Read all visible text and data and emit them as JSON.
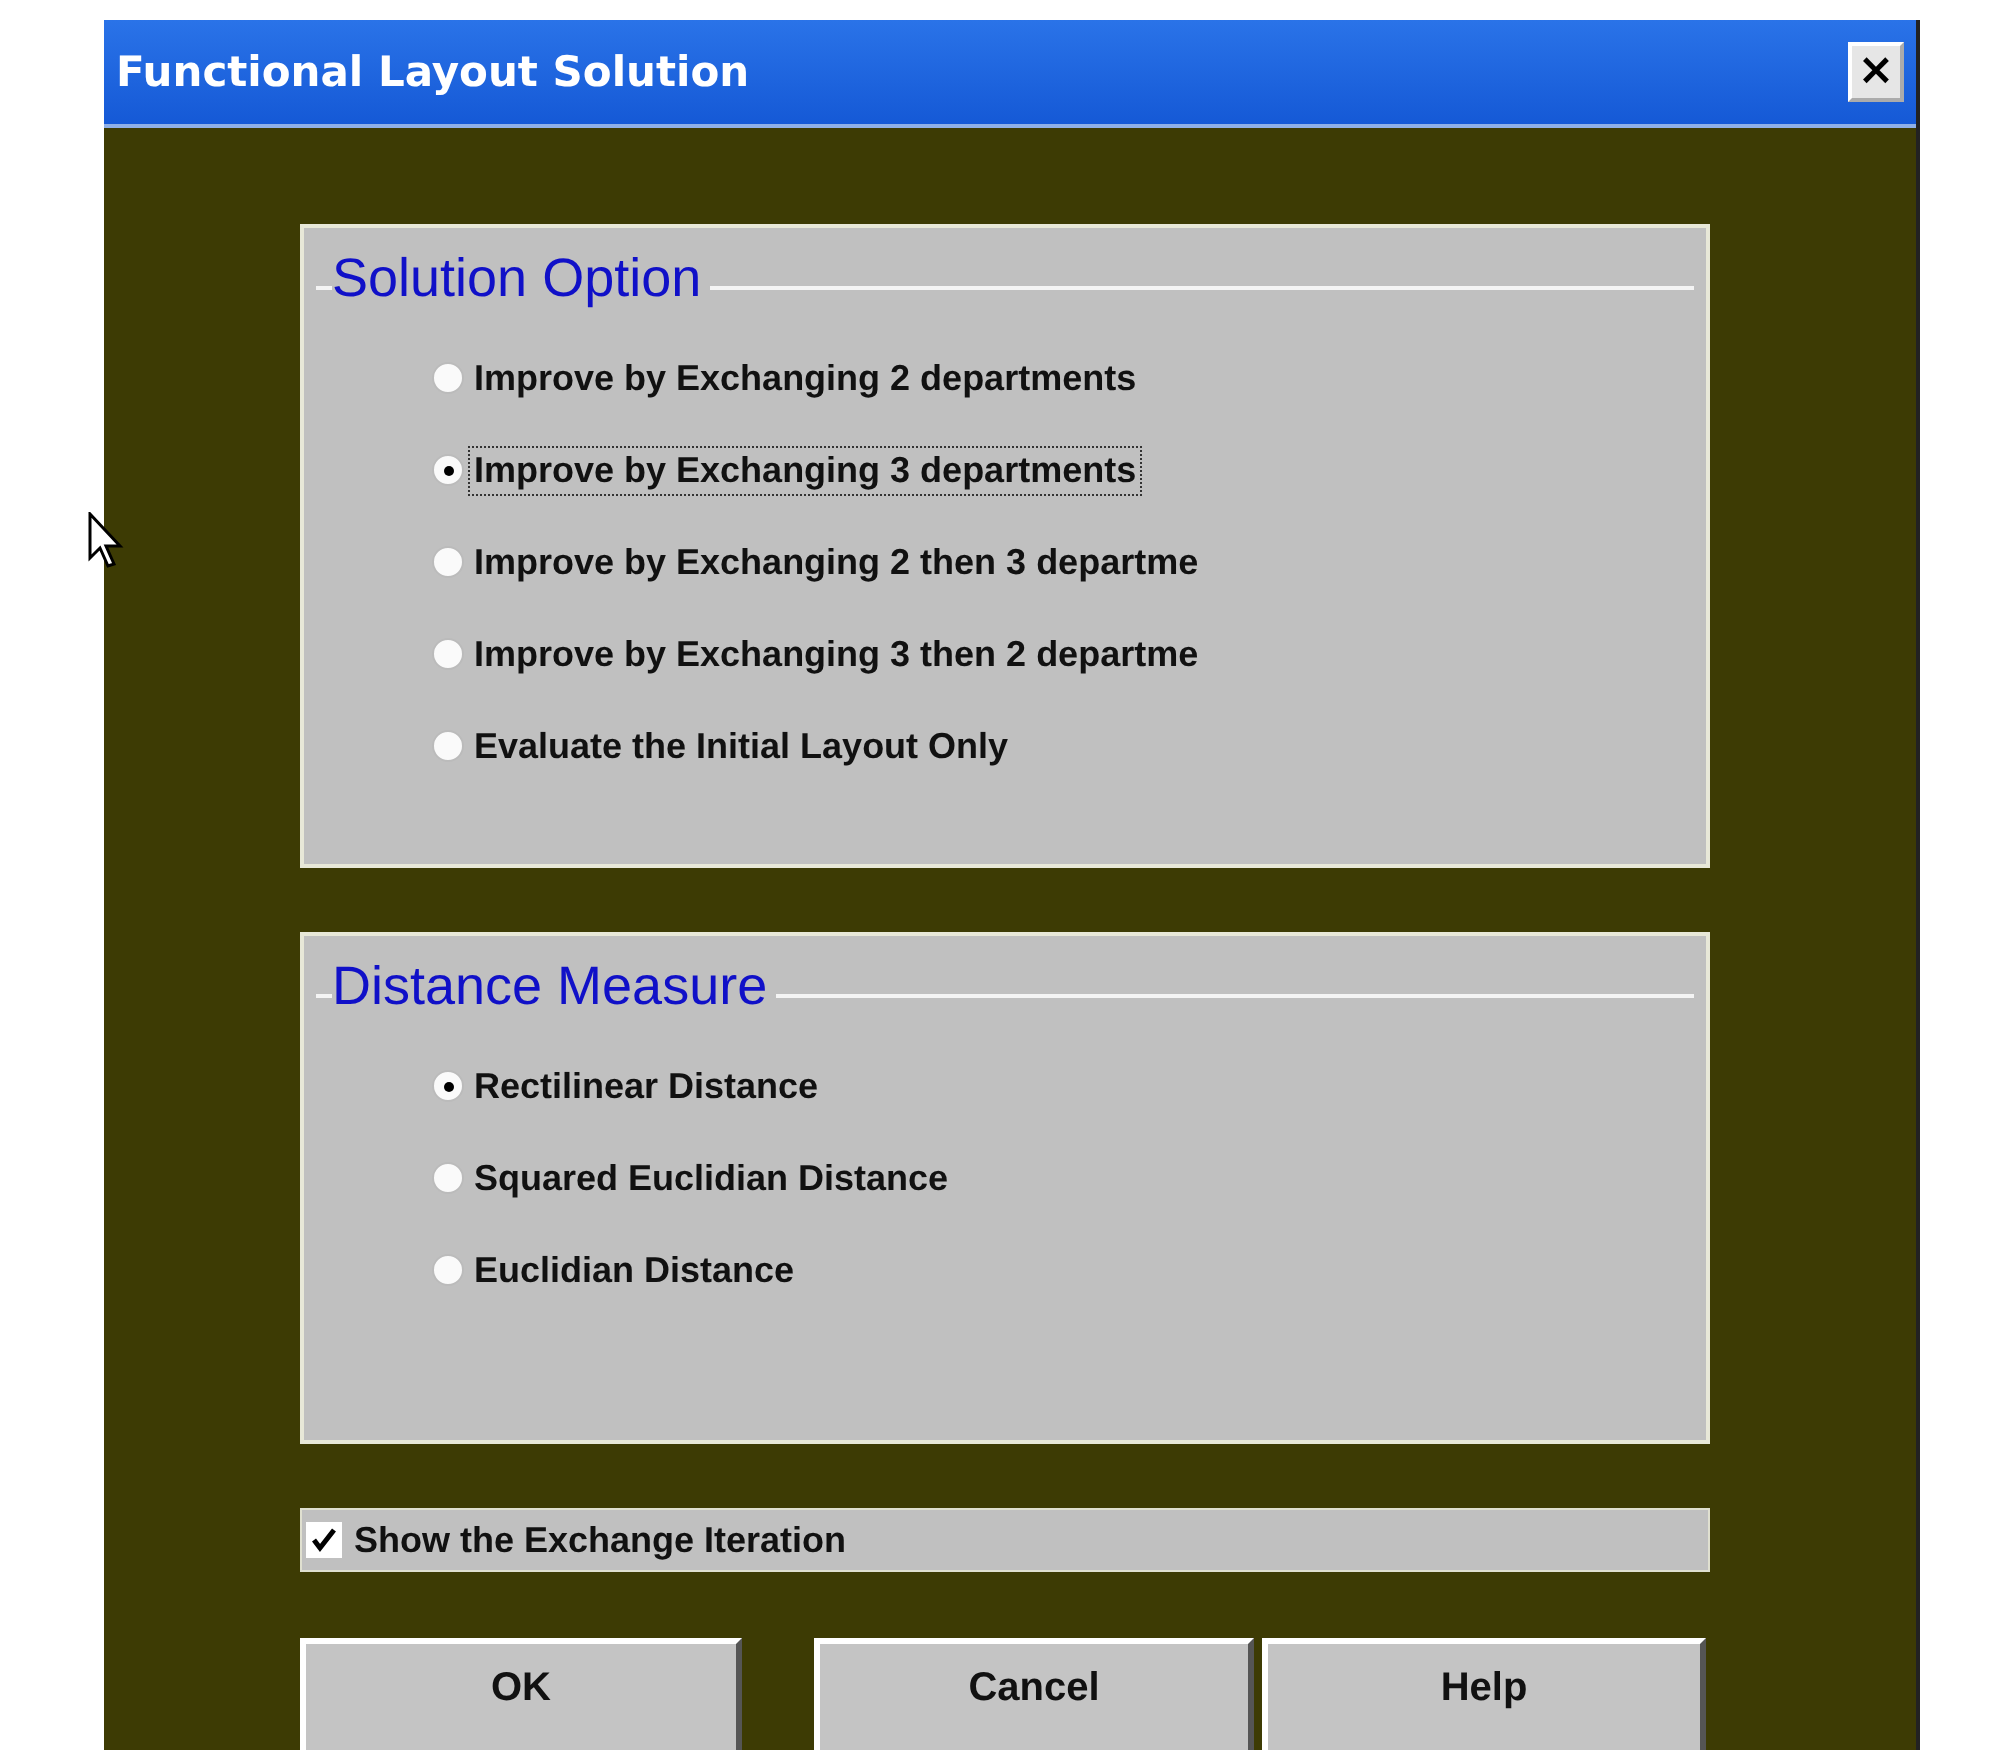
{
  "window": {
    "title": "Functional Layout Solution",
    "close": "×"
  },
  "groups": [
    {
      "title": "Solution Option",
      "options": [
        {
          "label": "Improve by Exchanging 2 departments",
          "selected": false
        },
        {
          "label": "Improve by Exchanging 3 departments",
          "selected": true
        },
        {
          "label": "Improve by Exchanging 2 then 3 departme",
          "selected": false
        },
        {
          "label": "Improve by Exchanging 3 then 2 departme",
          "selected": false
        },
        {
          "label": "Evaluate the Initial Layout Only",
          "selected": false
        }
      ]
    },
    {
      "title": "Distance Measure",
      "options": [
        {
          "label": "Rectilinear Distance",
          "selected": true
        },
        {
          "label": "Squared Euclidian Distance",
          "selected": false
        },
        {
          "label": "Euclidian Distance",
          "selected": false
        }
      ]
    }
  ],
  "show_iteration": {
    "label": "Show the Exchange Iteration",
    "checked": true
  },
  "buttons": [
    "OK",
    "Cancel",
    "Help"
  ]
}
